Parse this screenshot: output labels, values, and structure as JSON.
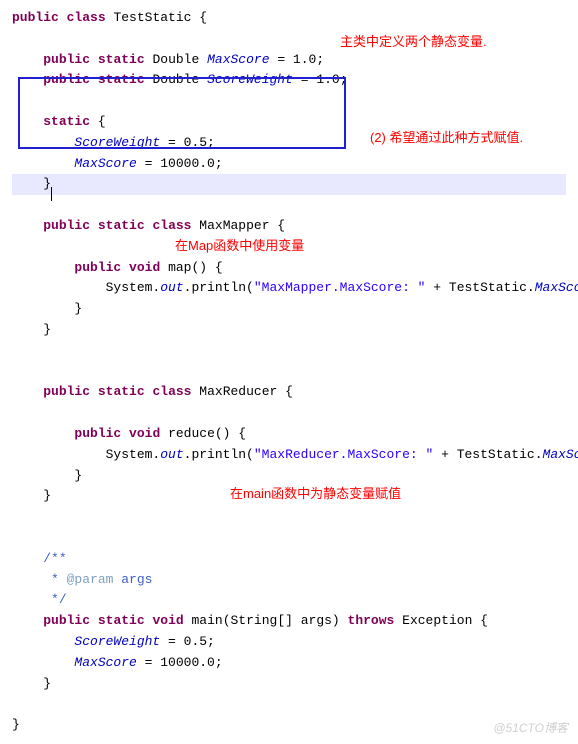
{
  "watermark": "@51CTO博客",
  "annotations": {
    "topRight": "主类中定义两个静态变量.",
    "boxRight": "(2) 希望通过此种方式赋值.",
    "mapNote": "在Map函数中使用变量",
    "mainNote": "在main函数中为静态变量赋值"
  },
  "code": {
    "kw_public": "public",
    "kw_static": "static",
    "kw_class": "class",
    "kw_void": "void",
    "kw_throws": "throws",
    "cls_TestStatic": "TestStatic {",
    "cls_MaxMapper": "MaxMapper {",
    "cls_MaxReducer": "MaxReducer {",
    "type_Double": "Double",
    "fld_MaxScore": "MaxScore",
    "fld_ScoreWeight": "ScoreWeight",
    "eq_one": " = 1.0;",
    "eq_half": " = 0.5;",
    "eq_10000": " = 10000.0;",
    "static_open": " {",
    "brace_close": "}",
    "fn_map_sig": "map() {",
    "fn_reduce_sig": "reduce() {",
    "sys_out": "System.",
    "out_field": "out",
    "println_open": ".println(",
    "println_close": ");",
    "str_mapper": "\"MaxMapper.MaxScore: \"",
    "str_reducer": "\"MaxReducer.MaxScore: \"",
    "plus_ts": " + TestStatic.",
    "doc_open": "/**",
    "doc_mid": " * ",
    "doc_param": "@param",
    "doc_args": " args",
    "doc_close": " */",
    "main_head": "main(String[] args) ",
    "exception": "Exception {"
  }
}
